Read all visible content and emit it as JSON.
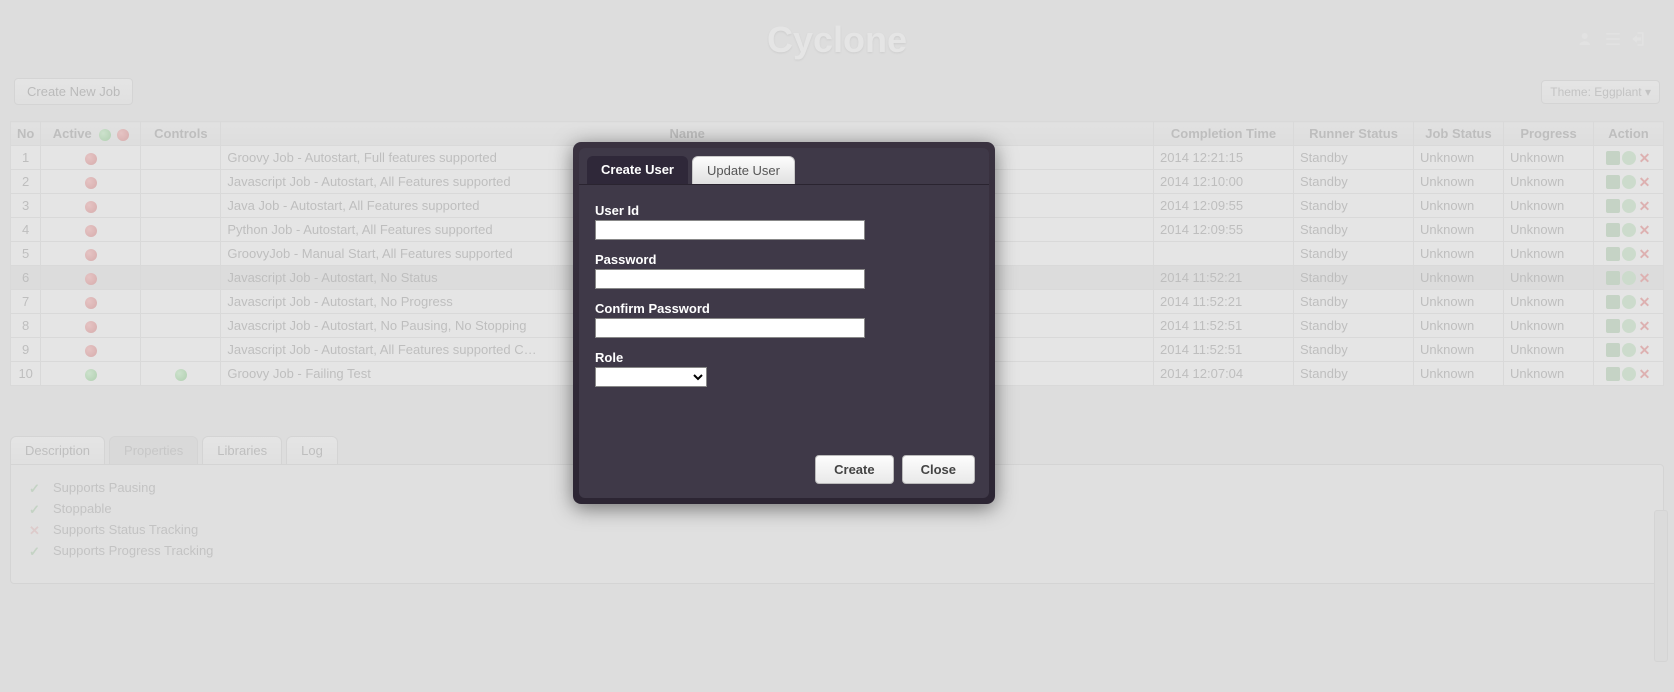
{
  "header": {
    "title": "Cyclone",
    "icons": [
      "users-icon",
      "settings-icon",
      "logout-icon"
    ]
  },
  "toolbar": {
    "create_job_label": "Create New Job",
    "theme_label": "Theme: Eggplant"
  },
  "columns": {
    "no": "No",
    "active": "Active",
    "controls": "Controls",
    "name": "Name",
    "completion": "Completion Time",
    "runner": "Runner Status",
    "jobstatus": "Job Status",
    "progress": "Progress",
    "action": "Action"
  },
  "rows": [
    {
      "no": "1",
      "active": "red",
      "controls": "",
      "name": "Groovy Job - Autostart, Full features supported",
      "completion": "2014 12:21:15",
      "runner": "Standby",
      "jobstatus": "Unknown",
      "progress": "Unknown",
      "selected": false
    },
    {
      "no": "2",
      "active": "red",
      "controls": "",
      "name": "Javascript Job - Autostart, All Features supported",
      "completion": "2014 12:10:00",
      "runner": "Standby",
      "jobstatus": "Unknown",
      "progress": "Unknown",
      "selected": false
    },
    {
      "no": "3",
      "active": "red",
      "controls": "",
      "name": "Java Job - Autostart, All Features supported",
      "completion": "2014 12:09:55",
      "runner": "Standby",
      "jobstatus": "Unknown",
      "progress": "Unknown",
      "selected": false
    },
    {
      "no": "4",
      "active": "red",
      "controls": "",
      "name": "Python Job - Autostart, All Features supported",
      "completion": "2014 12:09:55",
      "runner": "Standby",
      "jobstatus": "Unknown",
      "progress": "Unknown",
      "selected": false
    },
    {
      "no": "5",
      "active": "red",
      "controls": "",
      "name": "GroovyJob - Manual Start, All Features supported",
      "completion": "",
      "runner": "Standby",
      "jobstatus": "Unknown",
      "progress": "Unknown",
      "selected": false
    },
    {
      "no": "6",
      "active": "red",
      "controls": "",
      "name": "Javascript Job - Autostart, No Status",
      "completion": "2014 11:52:21",
      "runner": "Standby",
      "jobstatus": "Unknown",
      "progress": "Unknown",
      "selected": true
    },
    {
      "no": "7",
      "active": "red",
      "controls": "",
      "name": "Javascript Job - Autostart, No Progress",
      "completion": "2014 11:52:21",
      "runner": "Standby",
      "jobstatus": "Unknown",
      "progress": "Unknown",
      "selected": false
    },
    {
      "no": "8",
      "active": "red",
      "controls": "",
      "name": "Javascript Job - Autostart, No Pausing, No Stopping",
      "completion": "2014 11:52:51",
      "runner": "Standby",
      "jobstatus": "Unknown",
      "progress": "Unknown",
      "selected": false
    },
    {
      "no": "9",
      "active": "red",
      "controls": "",
      "name": "Javascript Job - Autostart, All Features supported C…",
      "completion": "2014 11:52:51",
      "runner": "Standby",
      "jobstatus": "Unknown",
      "progress": "Unknown",
      "selected": false
    },
    {
      "no": "10",
      "active": "green",
      "controls": "green",
      "name": "Groovy Job - Failing Test",
      "completion": "2014 12:07:04",
      "runner": "Standby",
      "jobstatus": "Unknown",
      "progress": "Unknown",
      "selected": false
    }
  ],
  "bottom_tabs": {
    "description": "Description",
    "properties": "Properties",
    "libraries": "Libraries",
    "log": "Log",
    "active": "properties"
  },
  "properties": [
    {
      "ok": true,
      "label": "Supports Pausing"
    },
    {
      "ok": true,
      "label": "Stoppable"
    },
    {
      "ok": false,
      "label": "Supports Status Tracking"
    },
    {
      "ok": true,
      "label": "Supports Progress Tracking"
    }
  ],
  "modal": {
    "tab_create": "Create User",
    "tab_update": "Update User",
    "userid_label": "User Id",
    "password_label": "Password",
    "confirm_label": "Confirm Password",
    "role_label": "Role",
    "userid_value": "",
    "password_value": "",
    "confirm_value": "",
    "role_value": "",
    "create_btn": "Create",
    "close_btn": "Close"
  }
}
